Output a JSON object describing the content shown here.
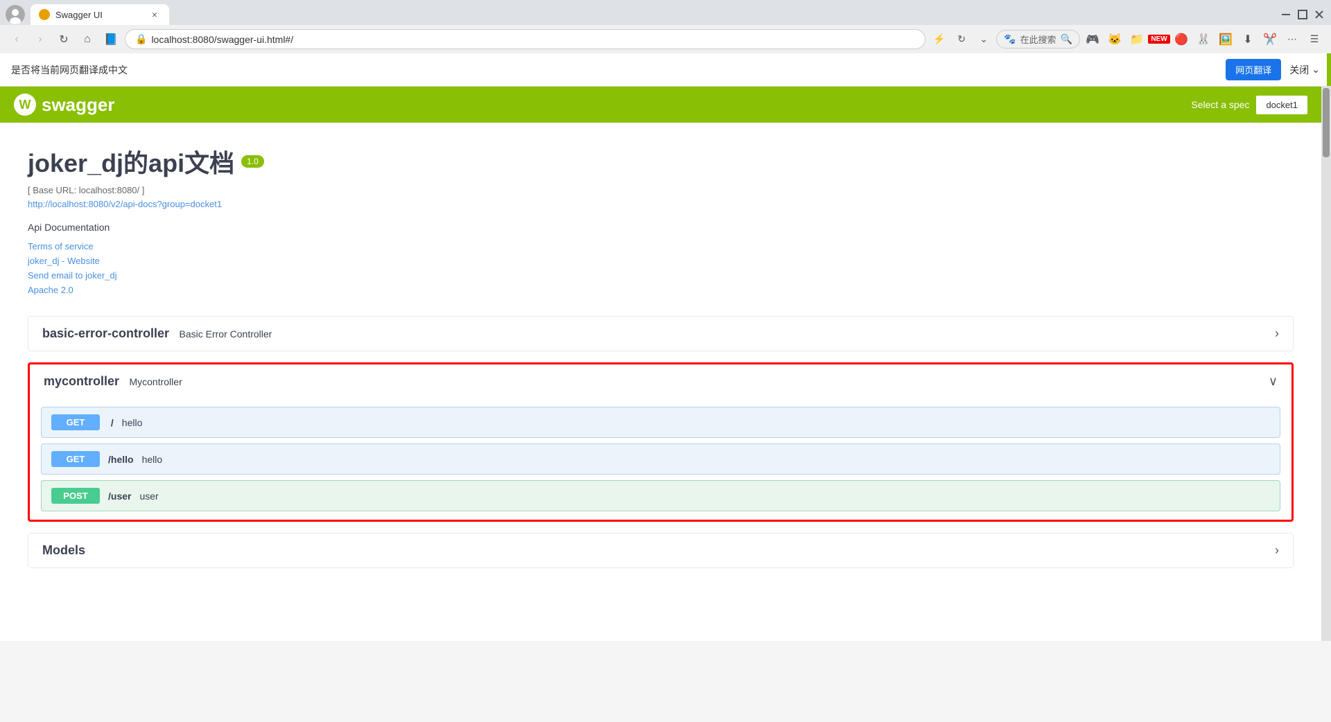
{
  "browser": {
    "tab_title": "Swagger UI",
    "tab_close": "×",
    "url": "localhost:8080/swagger-ui.html#/",
    "nav": {
      "back": "‹",
      "forward": "›",
      "refresh": "↻",
      "home": "⌂",
      "bookmarks": "📖",
      "star": "☆"
    }
  },
  "translation_bar": {
    "text": "是否将当前网页翻译成中文",
    "translate_btn": "网页翻译",
    "close_options": "关闭"
  },
  "swagger": {
    "logo": "swagger",
    "logo_icon": "W",
    "select_spec": "Select a spec",
    "docket_btn": "docket1"
  },
  "api": {
    "title": "joker_dj的api文档",
    "version": "1.0",
    "base_url": "[ Base URL: localhost:8080/ ]",
    "docs_link": "http://localhost:8080/v2/api-docs?group=docket1",
    "description": "Api Documentation",
    "terms_of_service": "Terms of service",
    "website": "joker_dj - Website",
    "email": "Send email to joker_dj",
    "license": "Apache 2.0"
  },
  "controllers": [
    {
      "id": "basic-error-controller",
      "name": "basic-error-controller",
      "desc": "Basic Error Controller",
      "expanded": false,
      "arrow": "›"
    },
    {
      "id": "mycontroller",
      "name": "mycontroller",
      "desc": "Mycontroller",
      "expanded": true,
      "arrow": "∨"
    }
  ],
  "endpoints": [
    {
      "method": "GET",
      "path": "/ ",
      "summary": "hello",
      "type": "get"
    },
    {
      "method": "GET",
      "path": "/hello",
      "summary": "hello",
      "type": "get"
    },
    {
      "method": "POST",
      "path": "/user",
      "summary": "user",
      "type": "post"
    }
  ],
  "models": {
    "label": "Models",
    "arrow": "›"
  }
}
